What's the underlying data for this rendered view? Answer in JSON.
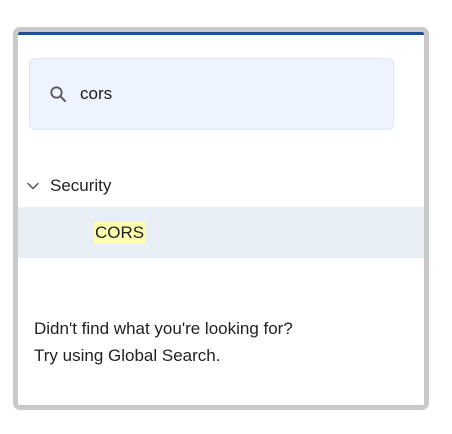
{
  "search": {
    "value": "cors",
    "icon": "search-icon"
  },
  "tree": {
    "group_label": "Security",
    "group_icon": "chevron-down-icon",
    "items": [
      {
        "label": "CORS"
      }
    ]
  },
  "no_results": {
    "line1": "Didn't find what you're looking for?",
    "line2": "Try using Global Search."
  },
  "colors": {
    "accent": "#1b5297",
    "search_bg": "#eef4ff",
    "selected_row_bg": "#e7eef4",
    "highlight": "#ffffb0",
    "panel_border": "#c9c9c9"
  }
}
